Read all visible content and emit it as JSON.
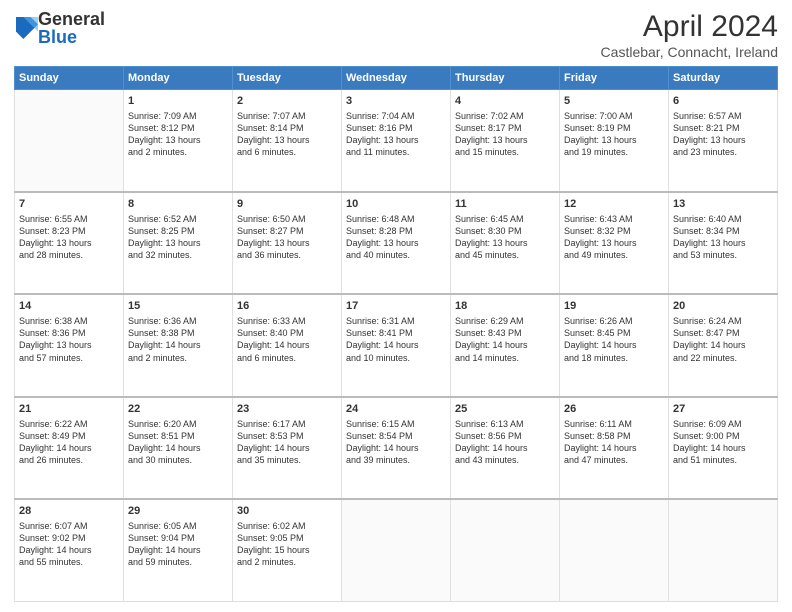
{
  "header": {
    "logo_general": "General",
    "logo_blue": "Blue",
    "month_title": "April 2024",
    "location": "Castlebar, Connacht, Ireland"
  },
  "calendar": {
    "days_of_week": [
      "Sunday",
      "Monday",
      "Tuesday",
      "Wednesday",
      "Thursday",
      "Friday",
      "Saturday"
    ],
    "weeks": [
      [
        {
          "day": "",
          "info": ""
        },
        {
          "day": "1",
          "info": "Sunrise: 7:09 AM\nSunset: 8:12 PM\nDaylight: 13 hours\nand 2 minutes."
        },
        {
          "day": "2",
          "info": "Sunrise: 7:07 AM\nSunset: 8:14 PM\nDaylight: 13 hours\nand 6 minutes."
        },
        {
          "day": "3",
          "info": "Sunrise: 7:04 AM\nSunset: 8:16 PM\nDaylight: 13 hours\nand 11 minutes."
        },
        {
          "day": "4",
          "info": "Sunrise: 7:02 AM\nSunset: 8:17 PM\nDaylight: 13 hours\nand 15 minutes."
        },
        {
          "day": "5",
          "info": "Sunrise: 7:00 AM\nSunset: 8:19 PM\nDaylight: 13 hours\nand 19 minutes."
        },
        {
          "day": "6",
          "info": "Sunrise: 6:57 AM\nSunset: 8:21 PM\nDaylight: 13 hours\nand 23 minutes."
        }
      ],
      [
        {
          "day": "7",
          "info": "Sunrise: 6:55 AM\nSunset: 8:23 PM\nDaylight: 13 hours\nand 28 minutes."
        },
        {
          "day": "8",
          "info": "Sunrise: 6:52 AM\nSunset: 8:25 PM\nDaylight: 13 hours\nand 32 minutes."
        },
        {
          "day": "9",
          "info": "Sunrise: 6:50 AM\nSunset: 8:27 PM\nDaylight: 13 hours\nand 36 minutes."
        },
        {
          "day": "10",
          "info": "Sunrise: 6:48 AM\nSunset: 8:28 PM\nDaylight: 13 hours\nand 40 minutes."
        },
        {
          "day": "11",
          "info": "Sunrise: 6:45 AM\nSunset: 8:30 PM\nDaylight: 13 hours\nand 45 minutes."
        },
        {
          "day": "12",
          "info": "Sunrise: 6:43 AM\nSunset: 8:32 PM\nDaylight: 13 hours\nand 49 minutes."
        },
        {
          "day": "13",
          "info": "Sunrise: 6:40 AM\nSunset: 8:34 PM\nDaylight: 13 hours\nand 53 minutes."
        }
      ],
      [
        {
          "day": "14",
          "info": "Sunrise: 6:38 AM\nSunset: 8:36 PM\nDaylight: 13 hours\nand 57 minutes."
        },
        {
          "day": "15",
          "info": "Sunrise: 6:36 AM\nSunset: 8:38 PM\nDaylight: 14 hours\nand 2 minutes."
        },
        {
          "day": "16",
          "info": "Sunrise: 6:33 AM\nSunset: 8:40 PM\nDaylight: 14 hours\nand 6 minutes."
        },
        {
          "day": "17",
          "info": "Sunrise: 6:31 AM\nSunset: 8:41 PM\nDaylight: 14 hours\nand 10 minutes."
        },
        {
          "day": "18",
          "info": "Sunrise: 6:29 AM\nSunset: 8:43 PM\nDaylight: 14 hours\nand 14 minutes."
        },
        {
          "day": "19",
          "info": "Sunrise: 6:26 AM\nSunset: 8:45 PM\nDaylight: 14 hours\nand 18 minutes."
        },
        {
          "day": "20",
          "info": "Sunrise: 6:24 AM\nSunset: 8:47 PM\nDaylight: 14 hours\nand 22 minutes."
        }
      ],
      [
        {
          "day": "21",
          "info": "Sunrise: 6:22 AM\nSunset: 8:49 PM\nDaylight: 14 hours\nand 26 minutes."
        },
        {
          "day": "22",
          "info": "Sunrise: 6:20 AM\nSunset: 8:51 PM\nDaylight: 14 hours\nand 30 minutes."
        },
        {
          "day": "23",
          "info": "Sunrise: 6:17 AM\nSunset: 8:53 PM\nDaylight: 14 hours\nand 35 minutes."
        },
        {
          "day": "24",
          "info": "Sunrise: 6:15 AM\nSunset: 8:54 PM\nDaylight: 14 hours\nand 39 minutes."
        },
        {
          "day": "25",
          "info": "Sunrise: 6:13 AM\nSunset: 8:56 PM\nDaylight: 14 hours\nand 43 minutes."
        },
        {
          "day": "26",
          "info": "Sunrise: 6:11 AM\nSunset: 8:58 PM\nDaylight: 14 hours\nand 47 minutes."
        },
        {
          "day": "27",
          "info": "Sunrise: 6:09 AM\nSunset: 9:00 PM\nDaylight: 14 hours\nand 51 minutes."
        }
      ],
      [
        {
          "day": "28",
          "info": "Sunrise: 6:07 AM\nSunset: 9:02 PM\nDaylight: 14 hours\nand 55 minutes."
        },
        {
          "day": "29",
          "info": "Sunrise: 6:05 AM\nSunset: 9:04 PM\nDaylight: 14 hours\nand 59 minutes."
        },
        {
          "day": "30",
          "info": "Sunrise: 6:02 AM\nSunset: 9:05 PM\nDaylight: 15 hours\nand 2 minutes."
        },
        {
          "day": "",
          "info": ""
        },
        {
          "day": "",
          "info": ""
        },
        {
          "day": "",
          "info": ""
        },
        {
          "day": "",
          "info": ""
        }
      ]
    ]
  }
}
